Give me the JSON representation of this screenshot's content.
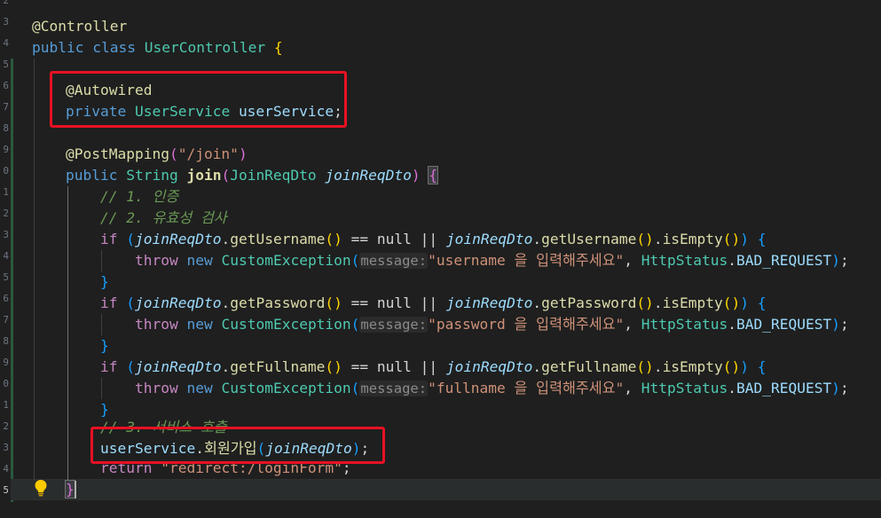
{
  "editor": {
    "line_numbers": [
      "2",
      "3",
      "4",
      "5",
      "6",
      "7",
      "8",
      "9",
      "0",
      "1",
      "2",
      "3",
      "4",
      "5",
      "6",
      "7",
      "8",
      "9",
      "0",
      "1",
      "2",
      "3",
      "4",
      "5"
    ],
    "current_line_number": "5",
    "lines": {
      "l0": {
        "annotation": "@Controller"
      },
      "l1": {
        "kw_public": "public",
        "kw_class": "class",
        "class_name": "UserController",
        "brace": "{"
      },
      "l3": {
        "annotation": "@Autowired"
      },
      "l4": {
        "kw_private": "private",
        "type": "UserService",
        "field": "userService",
        "semi": ";"
      },
      "l6": {
        "annotation": "@PostMapping",
        "paren_open": "(",
        "path": "\"/join\"",
        "paren_close": ")"
      },
      "l7": {
        "kw_public": "public",
        "ret_type": "String",
        "method": "join",
        "paren_open": "(",
        "param_type": "JoinReqDto",
        "param": "joinReqDto",
        "paren_close": ")",
        "brace": "{"
      },
      "l8": {
        "comment": "// 1. 인증"
      },
      "l9": {
        "comment": "// 2. 유효성 검사"
      },
      "l10": {
        "kw_if": "if",
        "cond_open": "(",
        "obj1": "joinReqDto",
        "getter1": "getUsername",
        "eq": "== null ||",
        "obj2": "joinReqDto",
        "getter2": "getUsername",
        "check": "isEmpty",
        "cond_close": ")",
        "brace": "{"
      },
      "l11": {
        "kw_throw": "throw",
        "kw_new": "new",
        "exc": "CustomException",
        "hint": "message:",
        "msg": "\"username 을 입력해주세요\"",
        "status_cls": "HttpStatus",
        "status": "BAD_REQUEST",
        "end": ");"
      },
      "l12": {
        "brace": "}"
      },
      "l13": {
        "kw_if": "if",
        "cond_open": "(",
        "obj1": "joinReqDto",
        "getter1": "getPassword",
        "eq": "== null ||",
        "obj2": "joinReqDto",
        "getter2": "getPassword",
        "check": "isEmpty",
        "cond_close": ")",
        "brace": "{"
      },
      "l14": {
        "kw_throw": "throw",
        "kw_new": "new",
        "exc": "CustomException",
        "hint": "message:",
        "msg": "\"password 을 입력해주세요\"",
        "status_cls": "HttpStatus",
        "status": "BAD_REQUEST",
        "end": ");"
      },
      "l15": {
        "brace": "}"
      },
      "l16": {
        "kw_if": "if",
        "cond_open": "(",
        "obj1": "joinReqDto",
        "getter1": "getFullname",
        "eq": "== null ||",
        "obj2": "joinReqDto",
        "getter2": "getFullname",
        "check": "isEmpty",
        "cond_close": ")",
        "brace": "{"
      },
      "l17": {
        "kw_throw": "throw",
        "kw_new": "new",
        "exc": "CustomException",
        "hint": "message:",
        "msg": "\"fullname 을 입력해주세요\"",
        "status_cls": "HttpStatus",
        "status": "BAD_REQUEST",
        "end": ");"
      },
      "l18": {
        "brace": "}"
      },
      "l19": {
        "comment": "// 3. 서비스 호출"
      },
      "l20": {
        "obj": "userService",
        "dot": ".",
        "method": "회원가입",
        "paren_open": "(",
        "arg": "joinReqDto",
        "paren_close": ")",
        "end": ";"
      },
      "l21": {
        "kw_return": "return",
        "str": "\"redirect:/loginForm\"",
        "end": ";"
      },
      "l22": {
        "brace": "}"
      }
    }
  },
  "colors": {
    "background": "#1f1f1f",
    "highlight_box": "#e81123",
    "lightbulb": "#ffcc00"
  },
  "icons": {
    "lightbulb": "lightbulb-icon"
  }
}
